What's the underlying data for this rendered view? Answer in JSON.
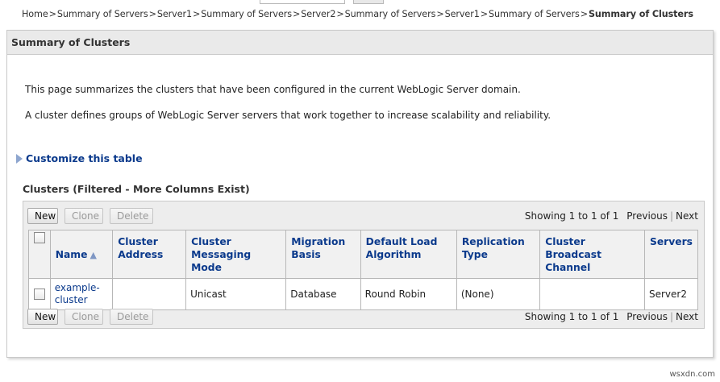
{
  "breadcrumb": {
    "items": [
      "Home",
      "Summary of Servers",
      "Server1",
      "Summary of Servers",
      "Server2",
      "Summary of Servers",
      "Server1",
      "Summary of Servers"
    ],
    "separator": ">",
    "current": "Summary of Clusters"
  },
  "panel": {
    "title": "Summary of Clusters",
    "description1": "This page summarizes the clusters that have been configured in the current WebLogic Server domain.",
    "description2": "A cluster defines groups of WebLogic Server servers that work together to increase scalability and reliability.",
    "customize_label": "Customize this table",
    "table_title": "Clusters (Filtered - More Columns Exist)"
  },
  "toolbar": {
    "new_label": "New",
    "clone_label": "Clone",
    "delete_label": "Delete"
  },
  "pager": {
    "showing": "Showing 1 to 1 of 1",
    "previous": "Previous",
    "next": "Next",
    "separator": "|"
  },
  "table": {
    "columns": [
      "Name",
      "Cluster Address",
      "Cluster Messaging Mode",
      "Migration Basis",
      "Default Load Algorithm",
      "Replication Type",
      "Cluster Broadcast Channel",
      "Servers"
    ],
    "rows": [
      {
        "name": "example-cluster",
        "cluster_address": "",
        "messaging_mode": "Unicast",
        "migration_basis": "Database",
        "load_algorithm": "Round Robin",
        "replication_type": "(None)",
        "broadcast_channel": "",
        "servers": "Server2"
      }
    ]
  },
  "icons": {
    "customize": "triangle-right-icon",
    "sort": "sort-ascending-icon"
  },
  "colors": {
    "link": "#0b3a8c",
    "header_bg": "#eaeaea",
    "toolbar_bg": "#ededed"
  },
  "watermark": "wsxdn.com"
}
